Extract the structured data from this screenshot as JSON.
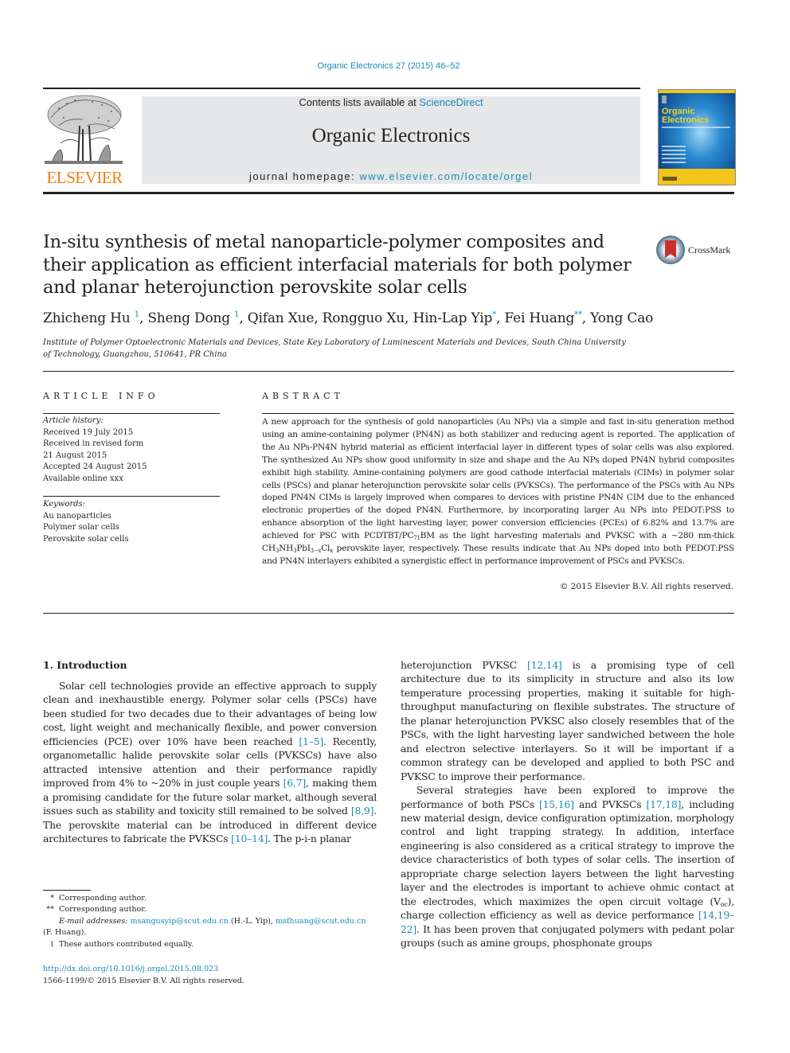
{
  "header": {
    "journal_ref": "Organic Electronics 27 (2015) 46–52",
    "contents_prefix": "Contents lists available at ",
    "contents_link": "ScienceDirect",
    "journal_name": "Organic Electronics",
    "homepage_prefix": "journal homepage: ",
    "homepage_link": "www.elsevier.com/locate/orgel",
    "publisher_logo_text": "ELSEVIER",
    "cover_title_line1": "Organic",
    "cover_title_line2": "Electronics"
  },
  "article": {
    "title": "In-situ synthesis of metal nanoparticle-polymer composites and their application as efficient interfacial materials for both polymer and planar heterojunction perovskite solar cells",
    "crossmark_label": "CrossMark",
    "authors": [
      {
        "name": "Zhicheng Hu",
        "mark": "1"
      },
      {
        "name": "Sheng Dong",
        "mark": "1"
      },
      {
        "name": "Qifan Xue",
        "mark": ""
      },
      {
        "name": "Rongguo Xu",
        "mark": ""
      },
      {
        "name": "Hin-Lap Yip",
        "mark": "*"
      },
      {
        "name": "Fei Huang",
        "mark": "**"
      },
      {
        "name": "Yong Cao",
        "mark": ""
      }
    ],
    "affiliation": "Institute of Polymer Optoelectronic Materials and Devices, State Key Laboratory of Luminescent Materials and Devices, South China University of Technology, Guangzhou, 510641, PR China"
  },
  "article_info": {
    "heading": "ARTICLE INFO",
    "history_label": "Article history:",
    "history": [
      "Received 19 July 2015",
      "Received in revised form",
      "21 August 2015",
      "Accepted 24 August 2015",
      "Available online xxx"
    ],
    "keywords_label": "Keywords:",
    "keywords": [
      "Au nanoparticles",
      "Polymer solar cells",
      "Perovskite solar cells"
    ]
  },
  "abstract": {
    "heading": "ABSTRACT",
    "part1": "A new approach for the synthesis of gold nanoparticles (Au NPs) via a simple and fast in-situ generation method using an amine-containing polymer (PN4N) as both stabilizer and reducing agent is reported. The application of the Au NPs-PN4N hybrid material as efficient interfacial layer in different types of solar cells was also explored. The synthesized Au NPs show good uniformity in size and shape and the Au NPs doped PN4N hybrid composites exhibit high stability. Amine-containing polymers are good cathode interfacial materials (CIMs) in polymer solar cells (PSCs) and planar heterojunction perovskite solar cells (PVKSCs). The performance of the PSCs with Au NPs doped PN4N CIMs is largely improved when compares to devices with pristine PN4N CIM due to the enhanced electronic properties of the doped PN4N. Furthermore, by incorporating larger Au NPs into PEDOT:PSS to enhance absorption of the light harvesting layer, power conversion efficiencies (PCEs) of 6.82% and 13.7% are achieved for PSC with PCDTBT/PC",
    "sub_71": "71",
    "part2": "BM as the light harvesting materials and PVKSC with a ~280 nm-thick CH",
    "sub_3a": "3",
    "part3": "NH",
    "sub_3b": "3",
    "part4": "PbI",
    "sub_3x": "3−x",
    "part5": "Cl",
    "sub_x": "x",
    "part6": " perovskite layer, respectively. These results indicate that Au NPs doped into both PEDOT:PSS and PN4N interlayers exhibited a synergistic effect in performance improvement of PSCs and PVKSCs.",
    "copyright": "© 2015 Elsevier B.V. All rights reserved."
  },
  "introduction": {
    "heading": "1.  Introduction",
    "left": {
      "t1": "Solar cell technologies provide an effective approach to supply clean and inexhaustible energy. Polymer solar cells (PSCs) have been studied for two decades due to their advantages of being low cost, light weight and mechanically flexible, and power conversion efficiencies (PCE) over 10% have been reached ",
      "r1": "[1–5]",
      "t2": ". Recently, organometallic halide perovskite solar cells (PVKSCs) have also attracted intensive attention and their performance rapidly improved from 4% to ~20% in just couple years ",
      "r2": "[6,7]",
      "t3": ", making them a promising candidate for the future solar market, although several issues such as stability and toxicity still remained to be solved ",
      "r3": "[8,9]",
      "t4": ". The perovskite material can be introduced in different device architectures to fabricate the PVKSCs ",
      "r4": "[10–14]",
      "t5": ". The p-i-n planar"
    },
    "right": {
      "p1_t1": "heterojunction PVKSC ",
      "p1_r1": "[12,14]",
      "p1_t2": " is a promising type of cell architecture due to its simplicity in structure and also its low temperature processing properties, making it suitable for high-throughput manufacturing on flexible substrates. The structure of the planar heterojunction PVKSC also closely resembles that of the PSCs, with the light harvesting layer sandwiched between the hole and electron selective interlayers. So it will be important if a common strategy can be developed and applied to both PSC and PVKSC to improve their performance.",
      "p2_t1": "Several strategies have been explored to improve the performance of both PSCs ",
      "p2_r1": "[15,16]",
      "p2_t2": " and PVKSCs ",
      "p2_r2": "[17,18]",
      "p2_t3": ", including new material design, device configuration optimization, morphology control and light trapping strategy. In addition, interface engineering is also considered as a critical strategy to improve the device characteristics of both types of solar cells. The insertion of appropriate charge selection layers between the light harvesting layer and the electrodes is important to achieve ohmic contact at the electrodes, which maximizes the open circuit voltage (V",
      "p2_sub": "oc",
      "p2_t4": "), charge collection efficiency as well as device performance ",
      "p2_r3": "[14,19–22]",
      "p2_t5": ". It has been proven that conjugated polymers with pedant polar groups (such as amine groups, phosphonate groups"
    }
  },
  "footnotes": {
    "fn1_mark": "*",
    "fn1_text": "Corresponding author.",
    "fn2_mark": "**",
    "fn2_text": "Corresponding author.",
    "email_label": "E-mail addresses:",
    "email1": "msangusyip@scut.edu.cn",
    "email1_owner": " (H.-L. Yip), ",
    "email2": "msfhuang@scut.edu.cn",
    "email2_owner": "(F. Huang).",
    "fn3_mark": "1",
    "fn3_text": "These authors contributed equally.",
    "doi": "http://dx.doi.org/10.1016/j.orgel.2015.08.023",
    "issn": "1566-1199/© 2015 Elsevier B.V. All rights reserved."
  },
  "colors": {
    "link": "#1a8bb9",
    "elsevier_orange": "#f07f15",
    "masthead_gray": "#e6e7e8",
    "text": "#231f20"
  }
}
